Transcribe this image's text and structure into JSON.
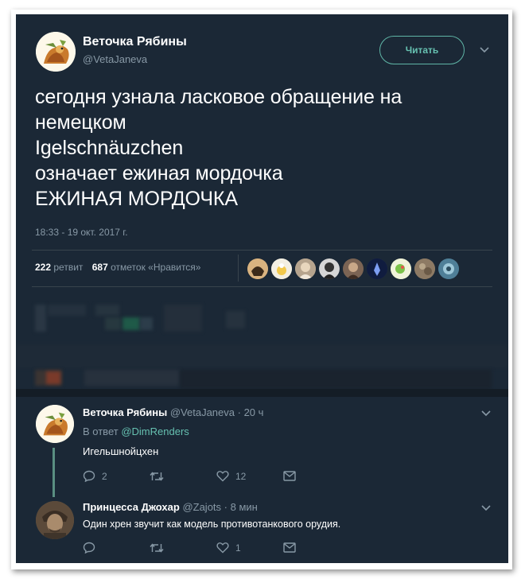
{
  "main_tweet": {
    "author_name": "Веточка Рябины",
    "author_handle": "@VetaJaneva",
    "follow_label": "Читать",
    "text_lines": [
      "сегодня узнала ласковое обращение на",
      "немецком",
      "Igelschnäuzchen",
      "означает ежиная мордочка",
      "ЕЖИНАЯ МОРДОЧКА"
    ],
    "timestamp": "18:33 - 19 окт. 2017 г.",
    "retweet_count": "222",
    "retweet_label": "ретвит",
    "like_count": "687",
    "like_label": "отметок «Нравится»",
    "likers_count": 9
  },
  "replies": [
    {
      "author_name": "Веточка Рябины",
      "author_handle": "@VetaJaneva",
      "time": "· 20 ч",
      "in_reply_prefix": "В ответ",
      "in_reply_to": "@DimRenders",
      "text": "Игельшнойцхен",
      "reply_count": "2",
      "retweet_count": "",
      "like_count": "12"
    },
    {
      "author_name": "Принцесса Джохар",
      "author_handle": "@Zajots",
      "time": "· 8 мин",
      "text": "Один хрен звучит как модель противотанкового орудия.",
      "reply_count": "",
      "retweet_count": "",
      "like_count": "1"
    }
  ],
  "colors": {
    "background": "#1b2836",
    "accent": "#66c0b0",
    "secondary_text": "#8899a6",
    "divider": "#38444d"
  },
  "icons": [
    "reply-icon",
    "retweet-icon",
    "like-icon",
    "direct-message-icon",
    "chevron-down-icon"
  ]
}
